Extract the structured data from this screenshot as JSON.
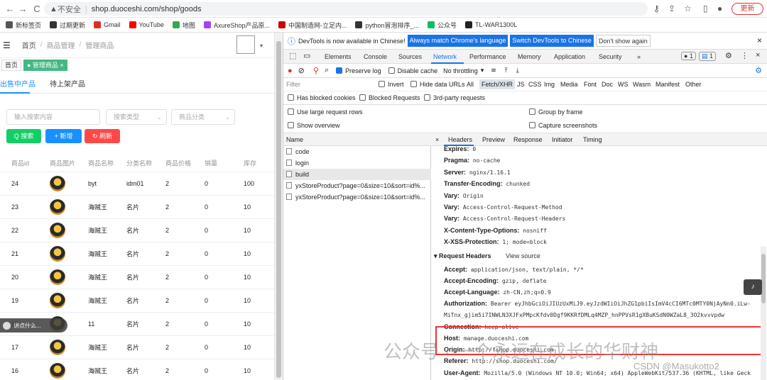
{
  "browser": {
    "back": "←",
    "forward": "→",
    "reload": "C",
    "security": "不安全",
    "url": "shop.duoceshi.com/shop/goods",
    "update_label": "更新"
  },
  "bookmarks": [
    {
      "label": "新标签页",
      "color": "#555"
    },
    {
      "label": "过期更新",
      "color": "#333"
    },
    {
      "label": "Gmail",
      "color": "#d93025"
    },
    {
      "label": "YouTube",
      "color": "#ff0000"
    },
    {
      "label": "地图",
      "color": "#34a853"
    },
    {
      "label": "AxureShop产品原...",
      "color": "#a142f4"
    },
    {
      "label": "中国制造网-立足内...",
      "color": "#cc0000"
    },
    {
      "label": "python冒泡排序_...",
      "color": "#333"
    },
    {
      "label": "公众号",
      "color": "#07c160"
    },
    {
      "label": "TL-WAR1300L",
      "color": "#222"
    }
  ],
  "page": {
    "breadcrumb": [
      "首页",
      "商品管理",
      "管理商品"
    ],
    "sep": "/",
    "tags": [
      {
        "label": "首页"
      },
      {
        "label": "● 管理商品 ×"
      }
    ],
    "tabs": [
      "出售中产品",
      "待上架产品"
    ],
    "filters": {
      "search_placeholder": "输入搜索内容",
      "type_placeholder": "搜索类型",
      "category_placeholder": "商品分类"
    },
    "buttons": {
      "search": "Q 搜索",
      "add": "+ 新增",
      "refresh": "↻ 刷新"
    },
    "columns": [
      "商品id",
      "商品图片",
      "商品名称",
      "分类名称",
      "商品价格",
      "销量",
      "库存"
    ],
    "rows": [
      {
        "id": "24",
        "name": "byt",
        "cat": "idm01",
        "price": "2",
        "sales": "0",
        "stock": "100"
      },
      {
        "id": "23",
        "name": "海贼王",
        "cat": "名片",
        "price": "2",
        "sales": "0",
        "stock": "10"
      },
      {
        "id": "22",
        "name": "海贼王",
        "cat": "名片",
        "price": "2",
        "sales": "0",
        "stock": "10"
      },
      {
        "id": "21",
        "name": "海贼王",
        "cat": "名片",
        "price": "2",
        "sales": "0",
        "stock": "10"
      },
      {
        "id": "20",
        "name": "海贼王",
        "cat": "名片",
        "price": "2",
        "sales": "0",
        "stock": "10"
      },
      {
        "id": "19",
        "name": "海贼王",
        "cat": "名片",
        "price": "2",
        "sales": "0",
        "stock": "10"
      },
      {
        "id": "18",
        "name": "11",
        "cat": "名片",
        "price": "2",
        "sales": "0",
        "stock": "10"
      },
      {
        "id": "17",
        "name": "海贼王",
        "cat": "名片",
        "price": "2",
        "sales": "0",
        "stock": "10"
      },
      {
        "id": "16",
        "name": "海贼王",
        "cat": "名片",
        "price": "2",
        "sales": "0",
        "stock": "10"
      }
    ],
    "toast": "讲点什么..."
  },
  "devtools": {
    "info": "DevTools is now available in Chinese!",
    "btn_match": "Always match Chrome's language",
    "btn_switch": "Switch DevTools to Chinese",
    "btn_dont": "Don't show again",
    "tabs": [
      "Elements",
      "Console",
      "Sources",
      "Network",
      "Performance",
      "Memory",
      "Application",
      "Security",
      "»"
    ],
    "badge1": "1",
    "badge2": "1",
    "toolbar": {
      "preserve": "Preserve log",
      "cache": "Disable cache",
      "throttle": "No throttling"
    },
    "filter": {
      "placeholder": "Filter",
      "invert": "Invert",
      "hide": "Hide data URLs",
      "types": [
        "All",
        "Fetch/XHR",
        "JS",
        "CSS",
        "Img",
        "Media",
        "Font",
        "Doc",
        "WS",
        "Wasm",
        "Manifest",
        "Other"
      ]
    },
    "blocked": {
      "cookies": "Has blocked cookies",
      "requests": "Blocked Requests",
      "third": "3rd-party requests"
    },
    "options": {
      "large": "Use large request rows",
      "group": "Group by frame",
      "overview": "Show overview",
      "screens": "Capture screenshots"
    },
    "name_header": "Name",
    "requests": [
      "code",
      "login",
      "build",
      "yxStoreProduct?page=0&size=10&sort=id%...",
      "yxStoreProduct?page=0&size=10&sort=id%..."
    ],
    "subtabs": [
      "×",
      "Headers",
      "Preview",
      "Response",
      "Initiator",
      "Timing"
    ],
    "headers": [
      {
        "k": "Expires:",
        "v": "0"
      },
      {
        "k": "Pragma:",
        "v": "no-cache"
      },
      {
        "k": "Server:",
        "v": "nginx/1.16.1"
      },
      {
        "k": "Transfer-Encoding:",
        "v": "chunked"
      },
      {
        "k": "Vary:",
        "v": "Origin"
      },
      {
        "k": "Vary:",
        "v": "Access-Control-Request-Method"
      },
      {
        "k": "Vary:",
        "v": "Access-Control-Request-Headers"
      },
      {
        "k": "X-Content-Type-Options:",
        "v": "nosniff"
      },
      {
        "k": "X-XSS-Protection:",
        "v": "1; mode=block"
      }
    ],
    "request_headers_title": "▾ Request Headers",
    "view_source": "View source",
    "req_headers": [
      {
        "k": "Accept:",
        "v": "application/json, text/plain, */*"
      },
      {
        "k": "Accept-Encoding:",
        "v": "gzip, deflate"
      },
      {
        "k": "Accept-Language:",
        "v": "zh-CN,zh;q=0.9"
      },
      {
        "k": "Authorization:",
        "v": "Bearer eyJhbGciOiJIUzUxMiJ9.eyJzdWIiOiJhZG1pbiIsImV4cCI6MTc0MTY0NjAyNn0.iLw-"
      },
      {
        "k": "",
        "v": "MiTnx_gjim5i7INWLN3XJFxPMpcKfdv0Dgf9KKRfDMLq4MZP_hnPPVsR1gXBuKSdN0WZaL8_3O2kvvvpdw"
      },
      {
        "k": "Connection:",
        "v": "keep-alive"
      },
      {
        "k": "Host:",
        "v": "manage.duoceshi.com"
      },
      {
        "k": "Origin:",
        "v": "http://fshop.duoceshi.com"
      },
      {
        "k": "Referer:",
        "v": "http://shop.duoceshi.com/"
      },
      {
        "k": "User-Agent:",
        "v": "Mozilla/5.0 (Windows NT 10.0; Win64; x64) AppleWebKit/537.36 (KHTML, like Geck"
      }
    ]
  },
  "watermark": {
    "wechat": "公众号 · 一个永远在成长的华财神",
    "csdn": "CSDN @Masukotto2"
  }
}
